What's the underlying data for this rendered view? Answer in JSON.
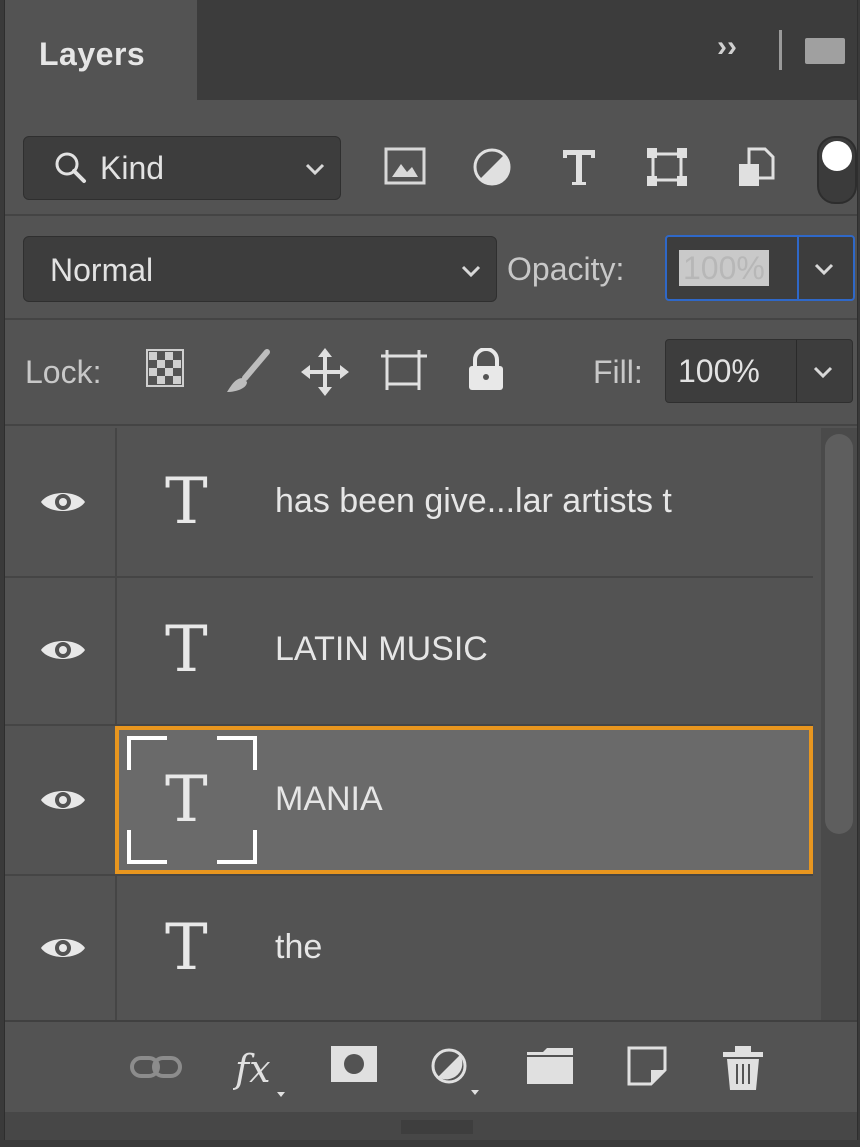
{
  "panel": {
    "title": "Layers"
  },
  "filter": {
    "kind_label": "Kind",
    "icons": [
      "image-filter-icon",
      "adjustment-filter-icon",
      "type-filter-icon",
      "shape-filter-icon",
      "smart-object-filter-icon"
    ]
  },
  "blend": {
    "mode": "Normal",
    "opacity_label": "Opacity:",
    "opacity_value": "100%"
  },
  "lock": {
    "label": "Lock:",
    "fill_label": "Fill:",
    "fill_value": "100%"
  },
  "layers": [
    {
      "name": "has been give...lar artists t",
      "type": "text",
      "visible": true,
      "selected": false
    },
    {
      "name": "LATIN MUSIC",
      "type": "text",
      "visible": true,
      "selected": false
    },
    {
      "name": "MANIA",
      "type": "text",
      "visible": true,
      "selected": true
    },
    {
      "name": "the",
      "type": "text",
      "visible": true,
      "selected": false
    }
  ],
  "colors": {
    "panel_bg": "#535353",
    "selection_outline": "#e8961f",
    "focus_blue": "#2f68c8"
  }
}
